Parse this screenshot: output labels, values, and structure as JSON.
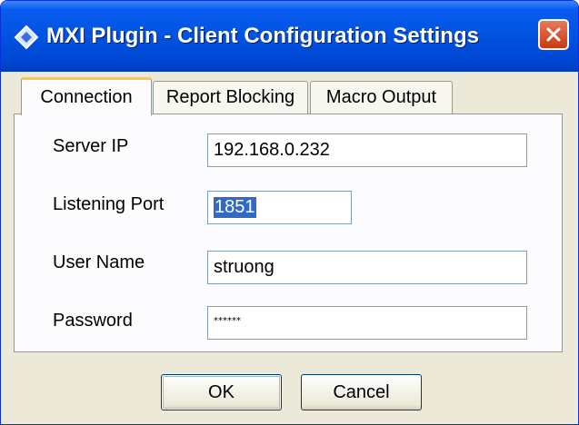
{
  "window": {
    "title": "MXI Plugin - Client Configuration Settings"
  },
  "tabs": [
    {
      "label": "Connection",
      "active": true
    },
    {
      "label": "Report Blocking",
      "active": false
    },
    {
      "label": "Macro Output",
      "active": false
    }
  ],
  "form": {
    "server_ip": {
      "label": "Server IP",
      "value": "192.168.0.232"
    },
    "listening_port": {
      "label": "Listening Port",
      "value": "1851"
    },
    "user_name": {
      "label": "User Name",
      "value": "struong"
    },
    "password": {
      "label": "Password",
      "value": "******"
    }
  },
  "buttons": {
    "ok": "OK",
    "cancel": "Cancel"
  },
  "colors": {
    "titlebar": "#0052e0",
    "selection": "#316ac5",
    "close": "#c73a12",
    "tab_highlight": "#ffc73c"
  }
}
